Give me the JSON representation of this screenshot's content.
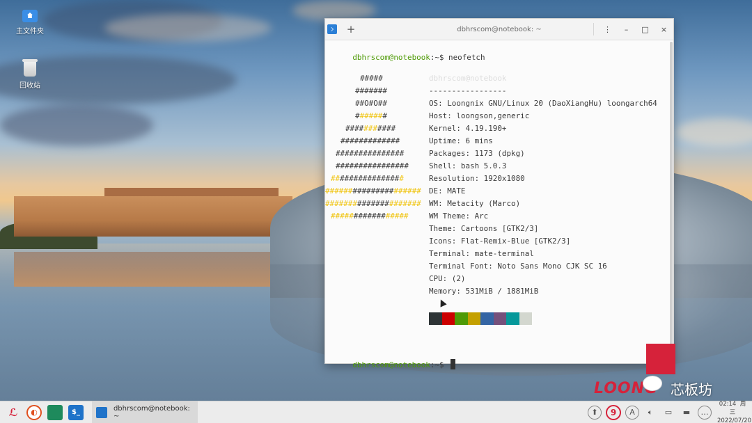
{
  "desktop": {
    "icons": [
      {
        "label": "主文件夹",
        "icon": "home-folder-icon"
      },
      {
        "label": "回收站",
        "icon": "trash-icon"
      }
    ]
  },
  "window": {
    "title": "dbhrscom@notebook: ~",
    "new_tab": "+",
    "controls": {
      "menu": "⋮",
      "minimize": "–",
      "maximize": "□",
      "close": "×"
    }
  },
  "terminal": {
    "prompt_user": "dbhrscom@notebook",
    "prompt_suffix": ":~$ ",
    "command": "neofetch",
    "header_user": "dbhrscom@notebook",
    "separator": "-----------------",
    "info": [
      "OS: Loongnix GNU/Linux 20 (DaoXiangHu) loongarch64",
      "Host: loongson,generic",
      "Kernel: 4.19.190+",
      "Uptime: 6 mins",
      "Packages: 1173 (dpkg)",
      "Shell: bash 5.0.3",
      "Resolution: 1920x1080",
      "DE: MATE",
      "WM: Metacity (Marco)",
      "WM Theme: Arc",
      "Theme: Cartoons [GTK2/3]",
      "Icons: Flat-Remix-Blue [GTK2/3]",
      "Terminal: mate-terminal",
      "Terminal Font: Noto Sans Mono CJK SC 16",
      "CPU: (2)",
      "Memory: 531MiB / 1881MiB"
    ],
    "palette": [
      "#2e3436",
      "#cc0000",
      "#4e9a06",
      "#c4a000",
      "#3465a4",
      "#75507b",
      "#06989a",
      "#d3d7cf"
    ],
    "logo": [
      [
        [
          "w",
          "#####"
        ]
      ],
      [
        [
          "w",
          "#######"
        ]
      ],
      [
        [
          "w",
          "##O#O##"
        ]
      ],
      [
        [
          "w",
          "#"
        ],
        [
          "y",
          "#####"
        ],
        [
          "w",
          "#"
        ]
      ],
      [
        [
          "w",
          "####"
        ],
        [
          "y",
          "###"
        ],
        [
          "w",
          "####"
        ]
      ],
      [
        [
          "w",
          "#############"
        ]
      ],
      [
        [
          "w",
          "###############"
        ]
      ],
      [
        [
          "w",
          "################"
        ]
      ],
      [
        [
          "y",
          "##"
        ],
        [
          "w",
          "#############"
        ],
        [
          "y",
          "#"
        ]
      ],
      [
        [
          "y",
          "######"
        ],
        [
          "w",
          "#########"
        ],
        [
          "y",
          "######"
        ]
      ],
      [
        [
          "y",
          "#######"
        ],
        [
          "w",
          "#######"
        ],
        [
          "y",
          "#######"
        ]
      ],
      [
        [
          "y",
          "#####"
        ],
        [
          "w",
          "#######"
        ],
        [
          "y",
          "#####"
        ]
      ]
    ]
  },
  "watermark": {
    "brand": "LOONG",
    "text": "芯板坊"
  },
  "taskbar": {
    "task_label": "dbhrscom@notebook: ~",
    "tray_badge": "9",
    "tray_a": "A",
    "clock_time": "02:14",
    "clock_day": "周三",
    "clock_date": "2022/07/20"
  }
}
